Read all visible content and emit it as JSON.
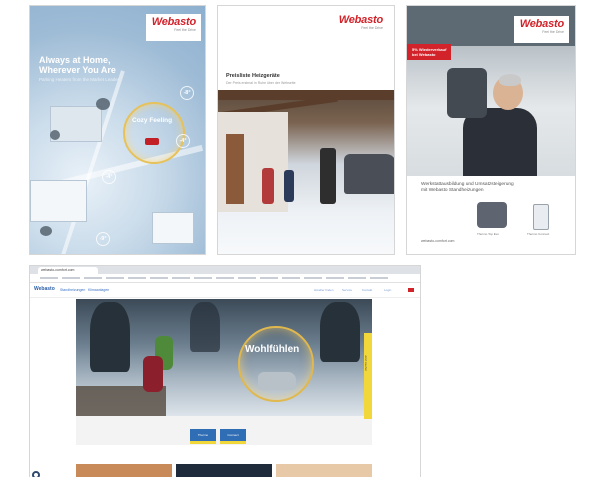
{
  "card1": {
    "logo": "Webasto",
    "tagline": "Feel the Drive",
    "headline_1": "Always at Home,",
    "headline_2": "Wherever You Are",
    "subline": "Parking Heaters from the Market Leader",
    "ring_text": "Cozy Feeling",
    "temps": [
      "-8°",
      "-4°",
      "-4°",
      "-9°"
    ]
  },
  "card2": {
    "logo": "Webasto",
    "tagline": "Feel the Drive",
    "title": "Preisliste Heizgeräte",
    "subtitle": "Der Preis erstmal in Ruhe über der Webseite"
  },
  "card3": {
    "logo": "Webasto",
    "tagline": "Feel the Drive",
    "badge_line_1": "5% Wiederverkauf",
    "badge_line_2": "bei Webasto",
    "panel_title_1": "Werkstattausbildung und Umsatzsteigerung",
    "panel_title_2": "mit Webasto Standheizungen",
    "product_label_1": "Thermo Top Evo",
    "product_label_2": "Thermo Connect",
    "url": "webasto-comfort.com"
  },
  "browser": {
    "tab_title": "webasto-comfort.com",
    "nav_logo": "Webasto",
    "nav_items": [
      "Standheizungen",
      "Klimaanlagen"
    ],
    "nav_right": [
      "Händler finden",
      "Service",
      "Kontakt",
      "Login"
    ],
    "hero_text": "Wohlfühlen",
    "side_tab": "Jetzt kaufen",
    "btn_1": "Thermo",
    "btn_2": "Connect"
  }
}
